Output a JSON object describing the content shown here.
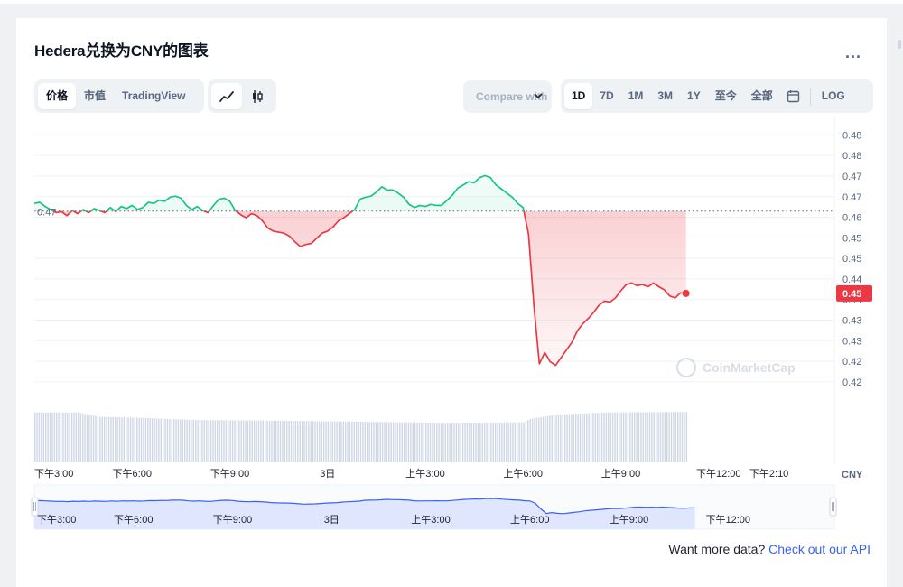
{
  "header": {
    "title": "Hedera兑换为CNY的图表",
    "more_label": "..."
  },
  "toolbar": {
    "view_tabs": [
      {
        "label": "价格",
        "active": true
      },
      {
        "label": "市值",
        "active": false
      },
      {
        "label": "TradingView",
        "active": false
      }
    ],
    "chart_types": [
      {
        "icon": "line-chart-icon",
        "active": true
      },
      {
        "icon": "candlestick-icon",
        "active": false
      }
    ],
    "compare_label": "Compare with",
    "ranges": [
      {
        "label": "1D",
        "active": true
      },
      {
        "label": "7D",
        "active": false
      },
      {
        "label": "1M",
        "active": false
      },
      {
        "label": "3M",
        "active": false
      },
      {
        "label": "1Y",
        "active": false
      },
      {
        "label": "至今",
        "active": false
      },
      {
        "label": "全部",
        "active": false
      }
    ],
    "calendar_icon": "calendar-icon",
    "log_label": "LOG"
  },
  "colors": {
    "up": "#16c784",
    "down": "#ea3943",
    "navigator_line": "#3861fb",
    "navigator_fill": "#dfe6fd",
    "volume": "#cfd6e4",
    "grid": "#eff2f5"
  },
  "chart_data": {
    "type": "line",
    "currency_label": "CNY",
    "reference_value": 0.4665,
    "reference_label": "0.47",
    "last_label": "0.45",
    "watermark": "CoinMarketCap",
    "grid": true,
    "y_axis": {
      "range": [
        0.4173,
        0.4833
      ],
      "ticks": [
        {
          "v": 0.4813,
          "label": "0.48"
        },
        {
          "v": 0.4773,
          "label": "0.48"
        },
        {
          "v": 0.4733,
          "label": "0.47"
        },
        {
          "v": 0.4693,
          "label": "0.47"
        },
        {
          "v": 0.4653,
          "label": "0.46"
        },
        {
          "v": 0.4613,
          "label": "0.45"
        },
        {
          "v": 0.4573,
          "label": "0.45"
        },
        {
          "v": 0.4533,
          "label": "0.44"
        },
        {
          "v": 0.4493,
          "label": "0.44"
        },
        {
          "v": 0.4453,
          "label": "0.43"
        },
        {
          "v": 0.4413,
          "label": "0.43"
        },
        {
          "v": 0.4373,
          "label": "0.42"
        },
        {
          "v": 0.4333,
          "label": "0.42"
        }
      ]
    },
    "x_axis": {
      "range": [
        0,
        1440
      ],
      "ticks": [
        {
          "t": 0,
          "label": "下午3:00"
        },
        {
          "t": 180,
          "label": "下午6:00"
        },
        {
          "t": 360,
          "label": "下午9:00"
        },
        {
          "t": 540,
          "label": "3日"
        },
        {
          "t": 720,
          "label": "上午3:00"
        },
        {
          "t": 900,
          "label": "上午6:00"
        },
        {
          "t": 1080,
          "label": "上午9:00"
        },
        {
          "t": 1260,
          "label": "下午12:00"
        },
        {
          "t": 1384,
          "label": "下午2:10"
        }
      ]
    },
    "series": [
      {
        "points": [
          [
            0,
            0.468
          ],
          [
            10,
            0.4682
          ],
          [
            20,
            0.4674
          ],
          [
            30,
            0.4668
          ],
          [
            40,
            0.4662
          ],
          [
            50,
            0.4664
          ],
          [
            60,
            0.4656
          ],
          [
            70,
            0.4666
          ],
          [
            80,
            0.466
          ],
          [
            90,
            0.4668
          ],
          [
            100,
            0.4662
          ],
          [
            110,
            0.467
          ],
          [
            120,
            0.4666
          ],
          [
            130,
            0.4662
          ],
          [
            140,
            0.4672
          ],
          [
            150,
            0.4664
          ],
          [
            160,
            0.4674
          ],
          [
            170,
            0.467
          ],
          [
            180,
            0.4676
          ],
          [
            190,
            0.4668
          ],
          [
            200,
            0.4672
          ],
          [
            210,
            0.4682
          ],
          [
            220,
            0.468
          ],
          [
            230,
            0.4686
          ],
          [
            240,
            0.4684
          ],
          [
            250,
            0.4692
          ],
          [
            260,
            0.4694
          ],
          [
            270,
            0.469
          ],
          [
            280,
            0.4676
          ],
          [
            290,
            0.4668
          ],
          [
            300,
            0.4674
          ],
          [
            310,
            0.4666
          ],
          [
            320,
            0.4662
          ],
          [
            330,
            0.4676
          ],
          [
            340,
            0.4688
          ],
          [
            350,
            0.469
          ],
          [
            360,
            0.4684
          ],
          [
            370,
            0.4666
          ],
          [
            380,
            0.4658
          ],
          [
            390,
            0.4652
          ],
          [
            400,
            0.466
          ],
          [
            410,
            0.4656
          ],
          [
            420,
            0.4646
          ],
          [
            430,
            0.4632
          ],
          [
            440,
            0.4626
          ],
          [
            450,
            0.4624
          ],
          [
            460,
            0.4622
          ],
          [
            470,
            0.4616
          ],
          [
            480,
            0.4605
          ],
          [
            490,
            0.4596
          ],
          [
            500,
            0.46
          ],
          [
            510,
            0.4602
          ],
          [
            520,
            0.4612
          ],
          [
            530,
            0.4622
          ],
          [
            540,
            0.4626
          ],
          [
            550,
            0.4634
          ],
          [
            560,
            0.4646
          ],
          [
            570,
            0.4652
          ],
          [
            580,
            0.466
          ],
          [
            590,
            0.4668
          ],
          [
            600,
            0.4688
          ],
          [
            610,
            0.4692
          ],
          [
            620,
            0.4694
          ],
          [
            630,
            0.4702
          ],
          [
            640,
            0.4712
          ],
          [
            650,
            0.4706
          ],
          [
            660,
            0.4706
          ],
          [
            670,
            0.47
          ],
          [
            680,
            0.4692
          ],
          [
            690,
            0.4678
          ],
          [
            700,
            0.4672
          ],
          [
            710,
            0.4676
          ],
          [
            720,
            0.4674
          ],
          [
            730,
            0.4678
          ],
          [
            740,
            0.4676
          ],
          [
            750,
            0.4676
          ],
          [
            760,
            0.4686
          ],
          [
            770,
            0.4696
          ],
          [
            780,
            0.471
          ],
          [
            790,
            0.4716
          ],
          [
            800,
            0.4722
          ],
          [
            810,
            0.472
          ],
          [
            820,
            0.473
          ],
          [
            830,
            0.4734
          ],
          [
            840,
            0.473
          ],
          [
            850,
            0.4716
          ],
          [
            860,
            0.4708
          ],
          [
            870,
            0.47
          ],
          [
            880,
            0.4692
          ],
          [
            890,
            0.468
          ],
          [
            900,
            0.4672
          ],
          [
            910,
            0.462
          ],
          [
            920,
            0.448
          ],
          [
            930,
            0.4368
          ],
          [
            940,
            0.439
          ],
          [
            950,
            0.4372
          ],
          [
            960,
            0.4365
          ],
          [
            970,
            0.438
          ],
          [
            980,
            0.4395
          ],
          [
            990,
            0.441
          ],
          [
            1000,
            0.4432
          ],
          [
            1010,
            0.4446
          ],
          [
            1020,
            0.4456
          ],
          [
            1030,
            0.4468
          ],
          [
            1040,
            0.4482
          ],
          [
            1050,
            0.449
          ],
          [
            1060,
            0.4488
          ],
          [
            1070,
            0.4496
          ],
          [
            1080,
            0.451
          ],
          [
            1090,
            0.4522
          ],
          [
            1100,
            0.4525
          ],
          [
            1110,
            0.452
          ],
          [
            1120,
            0.4522
          ],
          [
            1130,
            0.4518
          ],
          [
            1140,
            0.4525
          ],
          [
            1150,
            0.4518
          ],
          [
            1160,
            0.4512
          ],
          [
            1170,
            0.45
          ],
          [
            1180,
            0.4496
          ],
          [
            1190,
            0.4506
          ],
          [
            1200,
            0.4505
          ]
        ]
      }
    ],
    "volume": {
      "levels": [
        [
          0,
          0.92
        ],
        [
          80,
          0.92
        ],
        [
          120,
          0.84
        ],
        [
          200,
          0.82
        ],
        [
          300,
          0.78
        ],
        [
          450,
          0.77
        ],
        [
          600,
          0.75
        ],
        [
          750,
          0.73
        ],
        [
          900,
          0.74
        ],
        [
          912,
          0.8
        ],
        [
          960,
          0.88
        ],
        [
          1050,
          0.92
        ],
        [
          1200,
          0.93
        ]
      ]
    },
    "navigator": {
      "x_ticks": [
        {
          "t": 0,
          "label": "下午3:00"
        },
        {
          "t": 180,
          "label": "下午6:00"
        },
        {
          "t": 360,
          "label": "下午9:00"
        },
        {
          "t": 540,
          "label": "3日"
        },
        {
          "t": 720,
          "label": "上午3:00"
        },
        {
          "t": 900,
          "label": "上午6:00"
        },
        {
          "t": 1080,
          "label": "上午9:00"
        },
        {
          "t": 1260,
          "label": "下午12:00"
        }
      ]
    }
  },
  "footer": {
    "api_prefix": "Want more data? ",
    "api_link": "Check out our API"
  }
}
